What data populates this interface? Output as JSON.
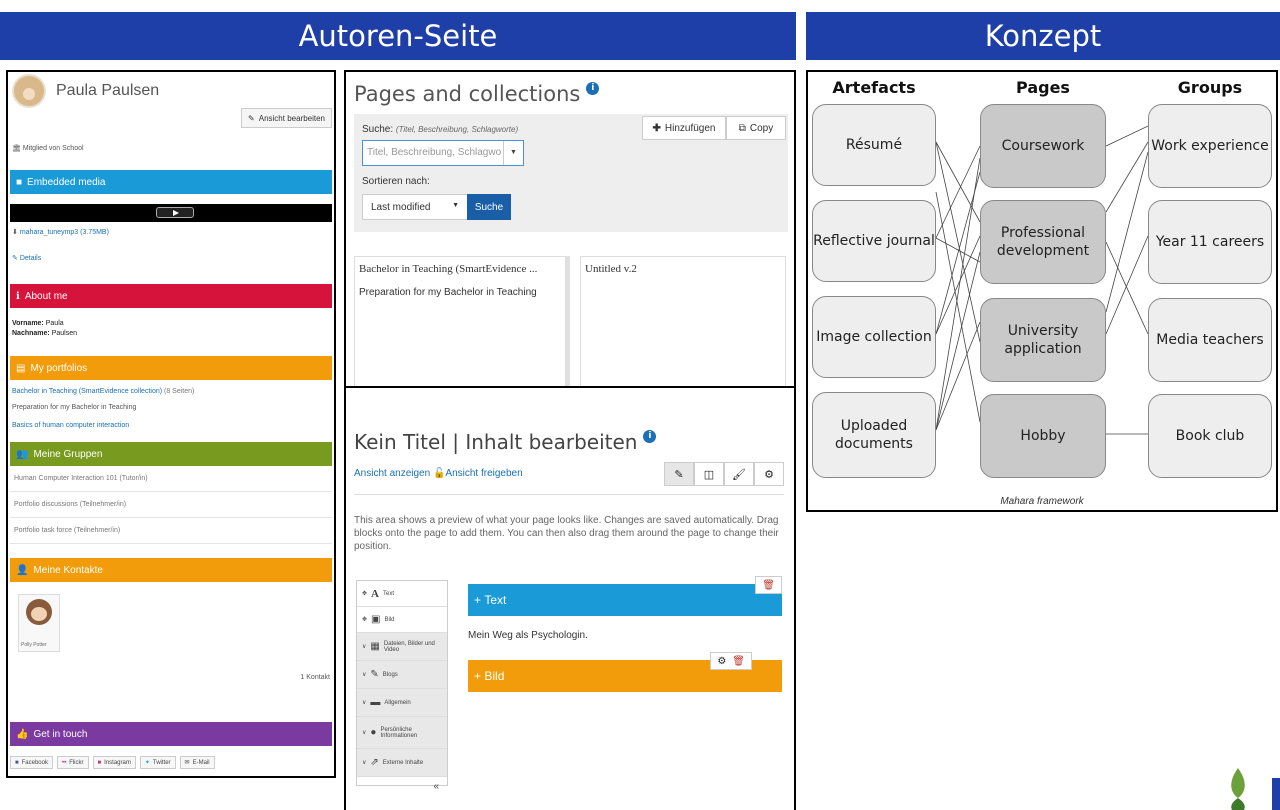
{
  "banners": {
    "left": "Autoren-Seite",
    "right": "Konzept"
  },
  "profile": {
    "name": "Paula Paulsen",
    "edit_button": "Ansicht bearbeiten",
    "member_of": "Mitglied von School",
    "embedded_media": "Embedded media",
    "media_file": "mahara_tuneymp3 (3.75MB)",
    "details": "Details",
    "about_me": "About me",
    "firstname_label": "Vorname:",
    "firstname": "Paula",
    "lastname_label": "Nachname:",
    "lastname": "Paulsen",
    "my_portfolios": "My portfolios",
    "portfolio_1": "Bachelor in Teaching (SmartEvidence collection)",
    "portfolio_1_count": "(8 Seiten)",
    "portfolio_1_desc": "Preparation for my Bachelor in Teaching",
    "portfolio_2": "Basics of human computer interaction",
    "groups_title": "Meine Gruppen",
    "groups": [
      {
        "name": "Human Computer Interaction 101",
        "role": "(Tutor/in)"
      },
      {
        "name": "Portfolio discussions",
        "role": "(Teilnehmer/in)"
      },
      {
        "name": "Portfolio task force",
        "role": "(Teilnehmer/in)"
      }
    ],
    "contacts_title": "Meine Kontakte",
    "contact_name": "Polly Potter",
    "contact_count": "1 Kontakt",
    "get_in_touch": "Get in touch",
    "social": [
      "Facebook",
      "Flickr",
      "Instagram",
      "Twitter",
      "E-Mail"
    ]
  },
  "pages": {
    "title": "Pages and collections",
    "search_label": "Suche:",
    "search_hint": "(Titel, Beschreibung, Schlagworte)",
    "search_placeholder": "Titel, Beschreibung, Schlagwo",
    "sort_label": "Sortieren nach:",
    "sort_value": "Last modified",
    "search_button": "Suche",
    "add_button": "Hinzufügen",
    "copy_button": "Copy",
    "cards": [
      {
        "title": "Bachelor in Teaching (SmartEvidence ...",
        "desc": "Preparation for my Bachelor in Teaching"
      },
      {
        "title": "Untitled v.2",
        "desc": ""
      }
    ]
  },
  "editor": {
    "title": "Kein Titel | Inhalt bearbeiten",
    "view_link": "Ansicht anzeigen",
    "share_link": "Ansicht freigeben",
    "description": "This area shows a preview of what your page looks like. Changes are saved automatically. Drag blocks onto the page to add them. You can then also drag them around the page to change their position.",
    "palette": [
      "Text",
      "Bild",
      "Dateien, Bilder und Video",
      "Blogs",
      "Allgemein",
      "Persönliche Informationen",
      "Externe Inhalte"
    ],
    "palette_footer": "«",
    "block_text_title": "Text",
    "block_text_content": "Mein Weg als Psychologin.",
    "block_image_title": "Bild"
  },
  "concept": {
    "headers": [
      "Artefacts",
      "Pages",
      "Groups"
    ],
    "artefacts": [
      "Résumé",
      "Reflective journal",
      "Image collection",
      "Uploaded documents"
    ],
    "pages": [
      "Coursework",
      "Professional development",
      "University application",
      "Hobby"
    ],
    "groups": [
      "Work experience",
      "Year 11 careers",
      "Media teachers",
      "Book club"
    ],
    "caption": "Mahara framework"
  },
  "colors": {
    "banner": "#1f3fa8",
    "blue_bar": "#1a9bd7",
    "red_bar": "#d5133b",
    "orange_bar": "#f39c0b",
    "green_bar": "#789a1f",
    "purple_bar": "#7a3aa0"
  }
}
